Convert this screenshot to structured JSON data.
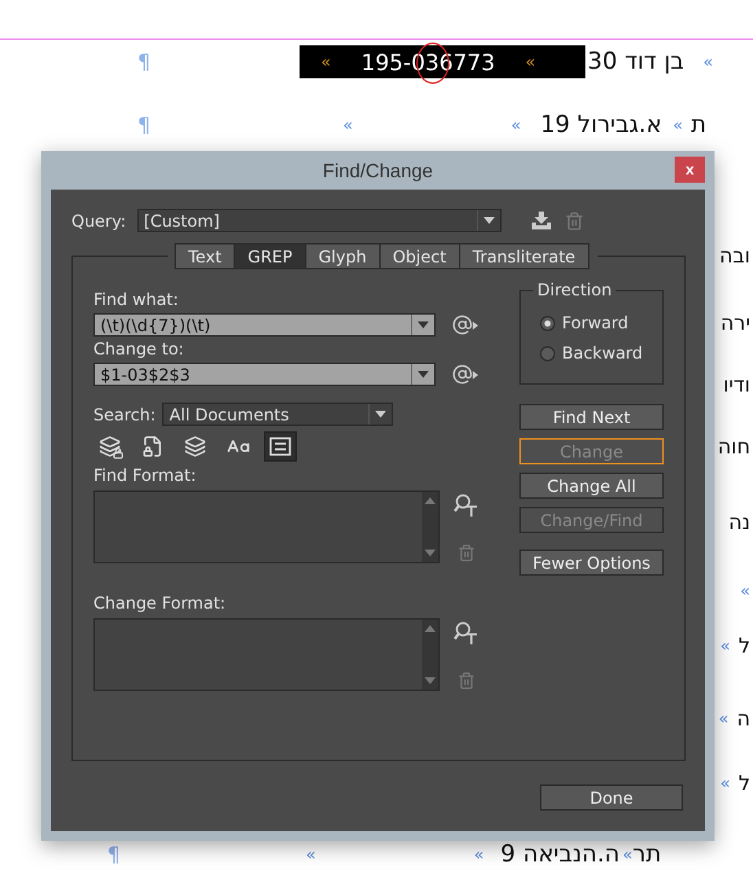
{
  "document": {
    "row_1": {
      "pilcrow": "¶",
      "phone_marks": [
        "«",
        "«"
      ],
      "phone": "195-036773",
      "address": "בן דוד 30",
      "marker": "«"
    },
    "row_2": {
      "pilcrow": "¶",
      "markers": [
        "«",
        "«"
      ],
      "address": "א.גבירול 19",
      "marker": "«",
      "edge_text": "ת"
    },
    "side_lines": [
      {
        "text": "ובה"
      },
      {
        "text": "ירה"
      },
      {
        "text": "ודיו"
      },
      {
        "text": "חוה"
      },
      {
        "text": "נה"
      },
      {
        "marker": "«"
      },
      {
        "marker": "«",
        "text": "ל"
      },
      {
        "marker": "«",
        "text": "ה"
      },
      {
        "marker": "«",
        "text": "ל"
      }
    ],
    "bottom_row": {
      "pilcrow": "¶",
      "markers": [
        "«",
        "«"
      ],
      "address": "ה.הנביאה 9",
      "marker": "«",
      "edge_text": "תר"
    }
  },
  "dialog": {
    "title": "Find/Change",
    "close": "x",
    "query": {
      "label": "Query:",
      "value": "[Custom]"
    },
    "tabs": [
      {
        "label": "Text",
        "selected": false
      },
      {
        "label": "GREP",
        "selected": true
      },
      {
        "label": "Glyph",
        "selected": false
      },
      {
        "label": "Object",
        "selected": false
      },
      {
        "label": "Transliterate",
        "selected": false
      }
    ],
    "find_what": {
      "label": "Find what:",
      "value": "(\\t)(\\d{7})(\\t)"
    },
    "change_to": {
      "label": "Change to:",
      "value": "$1-03$2$3"
    },
    "direction": {
      "title": "Direction",
      "options": [
        {
          "label": "Forward",
          "selected": true
        },
        {
          "label": "Backward",
          "selected": false
        }
      ]
    },
    "search": {
      "label": "Search:",
      "value": "All Documents"
    },
    "scope_toggles": [
      {
        "kind": "locked-layers",
        "on": false
      },
      {
        "kind": "locked-page",
        "on": false
      },
      {
        "kind": "layers",
        "on": false
      },
      {
        "kind": "case",
        "on": false
      },
      {
        "kind": "story",
        "on": true
      }
    ],
    "find_format": {
      "label": "Find Format:"
    },
    "change_format": {
      "label": "Change Format:"
    },
    "buttons": [
      {
        "label": "Find Next",
        "disabled": false,
        "focused": false
      },
      {
        "label": "Change",
        "disabled": true,
        "focused": true
      },
      {
        "label": "Change All",
        "disabled": false,
        "focused": false
      },
      {
        "label": "Change/Find",
        "disabled": true,
        "focused": false
      },
      {
        "label": "Fewer Options",
        "disabled": false,
        "focused": false
      }
    ],
    "done": "Done"
  }
}
